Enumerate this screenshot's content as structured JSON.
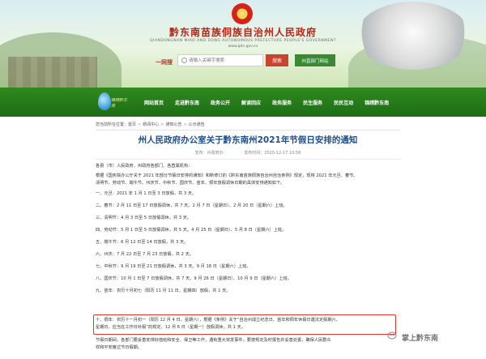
{
  "header": {
    "site_title": "黔东南苗族侗族自治州人民政府",
    "site_sub": "QIANDONGNAN MIAO AND DONG AUTONOMOUS PREFECTURE PEOPLE'S GOVERNMENT",
    "site_url": "www.qdn.gov.cn",
    "search_label": "一网搜",
    "search_placeholder": "请输入关键字搜索",
    "search_button": "搜索",
    "portal_button": "州直部门网站"
  },
  "nav": {
    "logo_text": "锦绣黔东南",
    "items": [
      "网站首页",
      "走进黔东南",
      "政务公开",
      "解读回应",
      "政务服务",
      "民生服务",
      "民民互动",
      "锦绣黔东南"
    ]
  },
  "breadcrumb": [
    "您当前所在位置：首页",
    "新闻中心",
    "通知公告",
    "公示通告"
  ],
  "article": {
    "title": "州人民政府办公室关于黔东南州2021年节假日安排的通知",
    "source": "发布：州政府办",
    "date": "发布时间：2020-12-17 10:58",
    "paragraphs": [
      "各县（市）人民政府，州政府各部门、各直属机构：",
      "    根据《国务院办公厅关于 2021 年部分节假日安排的通知》和新修订的《黔东南苗族侗族自治州自治条例》规定，现将 2021 年元旦、春节、",
      "清明节、劳动节、端午节、州庆节、中秋节、国庆节、苗年、侗年放假调休日期的具体安排通知如下。",
      "    一、元旦：2021 年 1 月 1 日至 3 日放假，共 3 天。",
      "    二、春节：2 月 11 日至 17 日放假调休，共 7 天。2 月 7 日（星期日）、2 月 20 日（星期六）上班。",
      "    三、清明节：4 月 3 日至 5 日放假调休，共 3 天。",
      "    四、劳动节：5 月 1 日至 5 日放假调休，共 5 天。4 月 25 日（星期日）、5 月 8 日（星期六）上班。",
      "    五、端午节：6 月 12 日至 14 日放假，共 3 天。",
      "    六、州庆：7 月 22 日至 7 月 23 日放假，共 2 天。",
      "    七、中秋节：9 月 19 日至 21 日放假调休，共 3 天。9 月 18 日（星期六）上班。",
      "    八、国庆节：10 月 1 日至 7 日放假调休，共 7 天。9 月 26 日（星期日）、10 月 9 日（星期六）上班。",
      "    九、苗年：农历十月初七（阳历 11 月 11 日，星期四）放假，共 1 天。",
      "    十、侗年：农历十一月初一（阳历 12 月 4 日，星期六），根据《条例》关于“自治州成立纪念日、苗年和侗年休假日遇法定假期六、",
      "星期日，应当在工作日补假”的规定，12 月 6 日（星期一）放假调休，共 1 天。",
      "    节假日期间，各部门要妥善安排好值班和安全、保卫等工作，遇有重大突发事件，要按规定及时报告并妥善处置，确保人民群众",
      "祥和平安度过节日假期。"
    ]
  },
  "watermark": "掌上黔东南"
}
